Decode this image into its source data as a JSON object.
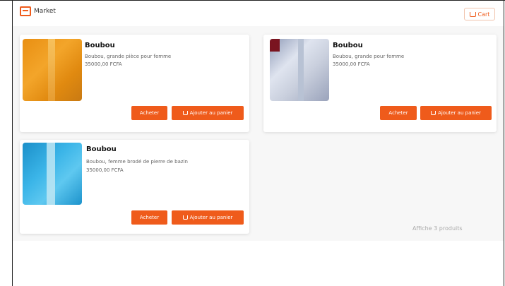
{
  "header": {
    "brand_name": "Market",
    "cart_label": "Cart"
  },
  "products": [
    {
      "title": "Boubou",
      "description": "Boubou, grande pièce pour femme",
      "price": "35000,00 FCFA",
      "buy_label": "Acheter",
      "add_label": "Ajouter au panier"
    },
    {
      "title": "Boubou",
      "description": "Boubou, grande pour femme",
      "price": "35000,00 FCFA",
      "buy_label": "Acheter",
      "add_label": "Ajouter au panier"
    },
    {
      "title": "Boubou",
      "description": "Boubou, femme brodé de pierre de bazin",
      "price": "35000,00 FCFA",
      "buy_label": "Acheter",
      "add_label": "Ajouter au panier"
    }
  ],
  "footer": {
    "note": "Affiche 3 produits"
  },
  "icons": {
    "brand": "store-icon",
    "cart": "cart-icon"
  },
  "colors": {
    "accent": "#ef5b1b"
  }
}
